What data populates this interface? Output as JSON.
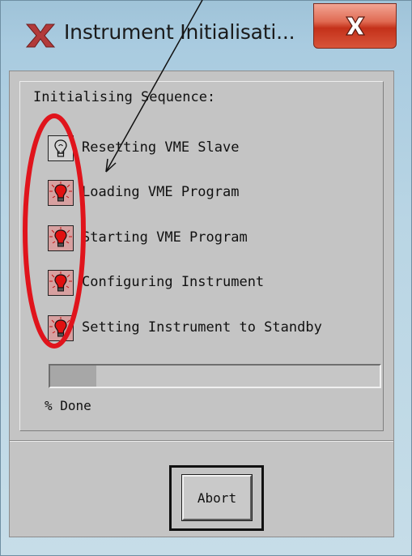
{
  "window": {
    "title": "Instrument Initialisati...",
    "close_label": "X"
  },
  "dialog": {
    "sequence_title": "Initialising Sequence:",
    "steps": [
      {
        "label": "Resetting VME Slave",
        "state": "active",
        "icon": "lightbulb-icon"
      },
      {
        "label": "Loading VME Program",
        "state": "pending",
        "icon": "red-lightbulb-icon"
      },
      {
        "label": "Starting VME Program",
        "state": "pending",
        "icon": "red-lightbulb-icon"
      },
      {
        "label": "Configuring Instrument",
        "state": "pending",
        "icon": "red-lightbulb-icon"
      },
      {
        "label": "Setting Instrument to Standby",
        "state": "pending",
        "icon": "red-lightbulb-icon"
      }
    ],
    "progress": {
      "fraction": 0.14
    },
    "progress_label": "% Done",
    "abort_label": "Abort"
  },
  "colors": {
    "annotation_red": "#e0141c",
    "bulb_red": "#e01010",
    "panel_gray": "#c4c4c4"
  }
}
